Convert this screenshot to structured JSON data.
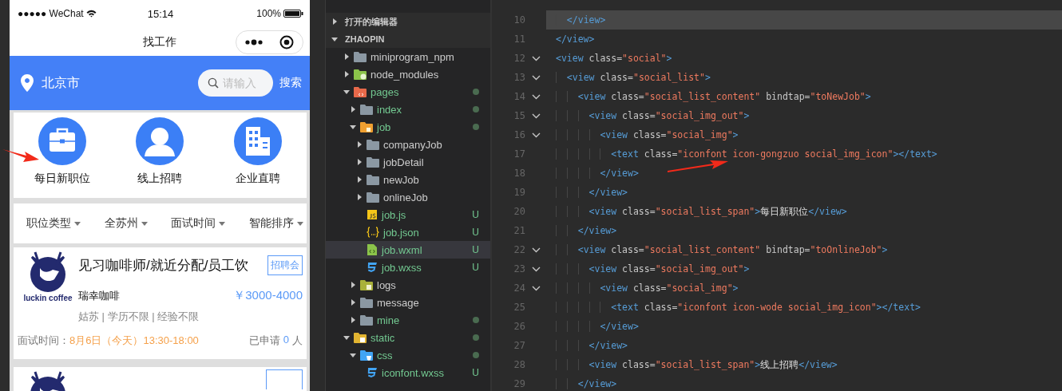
{
  "phone": {
    "status_bar": {
      "carrier": "●●●●● WeChat",
      "time": "15:14",
      "battery": "100%"
    },
    "nav": {
      "title": "找工作"
    },
    "header": {
      "city": "北京市",
      "search": {
        "placeholder": "请输入"
      },
      "search_button": "搜索"
    },
    "categories": [
      {
        "label": "每日新职位",
        "kind": "briefcase"
      },
      {
        "label": "线上招聘",
        "kind": "person"
      },
      {
        "label": "企业直聘",
        "kind": "building"
      }
    ],
    "filters": [
      "职位类型",
      "全苏州",
      "面试时间",
      "智能排序"
    ],
    "jobs": [
      {
        "logo_text": "luckin coffee",
        "title": "见习咖啡师/就近分配/员工饮",
        "badge": "招聘会",
        "company": "瑞幸咖啡",
        "salary": "￥3000-4000",
        "tags": "姑苏 | 学历不限 | 经验不限",
        "interview_label": "面试时间：",
        "interview_time": "8月6日（今天）13:30-18:00",
        "applied_label": "已申请",
        "applied_count": "0",
        "applied_unit": "人"
      }
    ]
  },
  "explorer": {
    "sections": [
      {
        "label": "打开的编辑器",
        "expanded": false
      },
      {
        "label": "ZHAOPIN",
        "expanded": true,
        "items": [
          {
            "name": "miniprogram_npm",
            "kind": "folder",
            "expanded": false,
            "changed": false,
            "modified": false,
            "selected": false
          },
          {
            "name": "node_modules",
            "kind": "folder-node",
            "expanded": false,
            "changed": false,
            "modified": false,
            "selected": false
          },
          {
            "name": "pages",
            "kind": "folder-pages",
            "expanded": true,
            "changed": true,
            "modified": true,
            "selected": false,
            "children": [
              {
                "name": "index",
                "kind": "folder",
                "expanded": false,
                "changed": true,
                "modified": true,
                "selected": false
              },
              {
                "name": "job",
                "kind": "folder-job",
                "expanded": true,
                "changed": true,
                "modified": true,
                "selected": false,
                "children": [
                  {
                    "name": "companyJob",
                    "kind": "folder",
                    "expanded": false,
                    "changed": false,
                    "modified": false,
                    "selected": false
                  },
                  {
                    "name": "jobDetail",
                    "kind": "folder",
                    "expanded": false,
                    "changed": false,
                    "modified": false,
                    "selected": false
                  },
                  {
                    "name": "newJob",
                    "kind": "folder",
                    "expanded": false,
                    "changed": false,
                    "modified": false,
                    "selected": false
                  },
                  {
                    "name": "onlineJob",
                    "kind": "folder",
                    "expanded": false,
                    "changed": false,
                    "modified": false,
                    "selected": false
                  },
                  {
                    "name": "job.js",
                    "kind": "js",
                    "changed": true,
                    "modified": false,
                    "badge": "U",
                    "selected": false
                  },
                  {
                    "name": "job.json",
                    "kind": "json",
                    "changed": true,
                    "modified": false,
                    "badge": "U",
                    "selected": false
                  },
                  {
                    "name": "job.wxml",
                    "kind": "wxml",
                    "changed": true,
                    "modified": false,
                    "badge": "U",
                    "selected": true
                  },
                  {
                    "name": "job.wxss",
                    "kind": "wxss",
                    "changed": true,
                    "modified": false,
                    "badge": "U",
                    "selected": false
                  }
                ]
              },
              {
                "name": "logs",
                "kind": "folder-logs",
                "expanded": false,
                "changed": false,
                "modified": false,
                "selected": false
              },
              {
                "name": "message",
                "kind": "folder",
                "expanded": false,
                "changed": false,
                "modified": false,
                "selected": false
              },
              {
                "name": "mine",
                "kind": "folder",
                "expanded": false,
                "changed": true,
                "modified": true,
                "selected": false
              }
            ]
          },
          {
            "name": "static",
            "kind": "folder-static",
            "expanded": true,
            "changed": true,
            "modified": true,
            "selected": false,
            "children": [
              {
                "name": "css",
                "kind": "folder-css",
                "expanded": true,
                "changed": true,
                "modified": true,
                "selected": false,
                "children": [
                  {
                    "name": "iconfont.wxss",
                    "kind": "wxss",
                    "changed": true,
                    "modified": false,
                    "badge": "U",
                    "selected": false
                  }
                ]
              }
            ]
          }
        ]
      }
    ]
  },
  "editor": {
    "lines": [
      {
        "number": "10",
        "current": true,
        "foldable": false,
        "tokens": [
          {
            "kind": "tag",
            "text": "  </view>"
          }
        ]
      },
      {
        "number": "11",
        "current": false,
        "foldable": false,
        "tokens": [
          {
            "kind": "tag",
            "text": "</view>"
          }
        ]
      },
      {
        "number": "12",
        "current": false,
        "foldable": true,
        "tokens": [
          {
            "kind": "tag",
            "text": "<view"
          },
          {
            "kind": "attr",
            "text": " class="
          },
          {
            "kind": "string",
            "text": "\"social\""
          },
          {
            "kind": "tag",
            "text": ">"
          }
        ]
      },
      {
        "number": "13",
        "current": false,
        "foldable": true,
        "tokens": [
          {
            "kind": "tag",
            "text": "  <view"
          },
          {
            "kind": "attr",
            "text": " class="
          },
          {
            "kind": "string",
            "text": "\"social_list\""
          },
          {
            "kind": "tag",
            "text": ">"
          }
        ]
      },
      {
        "number": "14",
        "current": false,
        "foldable": true,
        "tokens": [
          {
            "kind": "tag",
            "text": "    <view"
          },
          {
            "kind": "attr",
            "text": " class="
          },
          {
            "kind": "string",
            "text": "\"social_list_content\""
          },
          {
            "kind": "attr",
            "text": " bindtap="
          },
          {
            "kind": "string",
            "text": "\"toNewJob\""
          },
          {
            "kind": "tag",
            "text": ">"
          }
        ]
      },
      {
        "number": "15",
        "current": false,
        "foldable": true,
        "tokens": [
          {
            "kind": "tag",
            "text": "      <view"
          },
          {
            "kind": "attr",
            "text": " class="
          },
          {
            "kind": "string",
            "text": "\"social_img_out\""
          },
          {
            "kind": "tag",
            "text": ">"
          }
        ]
      },
      {
        "number": "16",
        "current": false,
        "foldable": true,
        "tokens": [
          {
            "kind": "tag",
            "text": "        <view"
          },
          {
            "kind": "attr",
            "text": " class="
          },
          {
            "kind": "string",
            "text": "\"social_img\""
          },
          {
            "kind": "tag",
            "text": ">"
          }
        ]
      },
      {
        "number": "17",
        "current": false,
        "foldable": false,
        "tokens": [
          {
            "kind": "tag",
            "text": "          <text"
          },
          {
            "kind": "attr",
            "text": " class="
          },
          {
            "kind": "string",
            "text": "\"iconfont icon-gongzuo social_img_icon\""
          },
          {
            "kind": "tag",
            "text": "></text>"
          }
        ]
      },
      {
        "number": "18",
        "current": false,
        "foldable": false,
        "tokens": [
          {
            "kind": "tag",
            "text": "        </view>"
          }
        ]
      },
      {
        "number": "19",
        "current": false,
        "foldable": false,
        "tokens": [
          {
            "kind": "tag",
            "text": "      </view>"
          }
        ]
      },
      {
        "number": "20",
        "current": false,
        "foldable": false,
        "tokens": [
          {
            "kind": "tag",
            "text": "      <view"
          },
          {
            "kind": "attr",
            "text": " class="
          },
          {
            "kind": "string",
            "text": "\"social_list_span\""
          },
          {
            "kind": "tag",
            "text": ">"
          },
          {
            "kind": "text",
            "text": "每日新职位"
          },
          {
            "kind": "tag",
            "text": "</view>"
          }
        ]
      },
      {
        "number": "21",
        "current": false,
        "foldable": false,
        "tokens": [
          {
            "kind": "tag",
            "text": "    </view>"
          }
        ]
      },
      {
        "number": "22",
        "current": false,
        "foldable": true,
        "tokens": [
          {
            "kind": "tag",
            "text": "    <view"
          },
          {
            "kind": "attr",
            "text": " class="
          },
          {
            "kind": "string",
            "text": "\"social_list_content\""
          },
          {
            "kind": "attr",
            "text": " bindtap="
          },
          {
            "kind": "string",
            "text": "\"toOnlineJob\""
          },
          {
            "kind": "tag",
            "text": ">"
          }
        ]
      },
      {
        "number": "23",
        "current": false,
        "foldable": true,
        "tokens": [
          {
            "kind": "tag",
            "text": "      <view"
          },
          {
            "kind": "attr",
            "text": " class="
          },
          {
            "kind": "string",
            "text": "\"social_img_out\""
          },
          {
            "kind": "tag",
            "text": ">"
          }
        ]
      },
      {
        "number": "24",
        "current": false,
        "foldable": true,
        "tokens": [
          {
            "kind": "tag",
            "text": "        <view"
          },
          {
            "kind": "attr",
            "text": " class="
          },
          {
            "kind": "string",
            "text": "\"social_img\""
          },
          {
            "kind": "tag",
            "text": ">"
          }
        ]
      },
      {
        "number": "25",
        "current": false,
        "foldable": false,
        "tokens": [
          {
            "kind": "tag",
            "text": "          <text"
          },
          {
            "kind": "attr",
            "text": " class="
          },
          {
            "kind": "string",
            "text": "\"iconfont icon-wode social_img_icon\""
          },
          {
            "kind": "tag",
            "text": "></text>"
          }
        ]
      },
      {
        "number": "26",
        "current": false,
        "foldable": false,
        "tokens": [
          {
            "kind": "tag",
            "text": "        </view>"
          }
        ]
      },
      {
        "number": "27",
        "current": false,
        "foldable": false,
        "tokens": [
          {
            "kind": "tag",
            "text": "      </view>"
          }
        ]
      },
      {
        "number": "28",
        "current": false,
        "foldable": false,
        "tokens": [
          {
            "kind": "tag",
            "text": "      <view"
          },
          {
            "kind": "attr",
            "text": " class="
          },
          {
            "kind": "string",
            "text": "\"social_list_span\""
          },
          {
            "kind": "tag",
            "text": ">"
          },
          {
            "kind": "text",
            "text": "线上招聘"
          },
          {
            "kind": "tag",
            "text": "</view>"
          }
        ]
      },
      {
        "number": "29",
        "current": false,
        "foldable": false,
        "tokens": [
          {
            "kind": "tag",
            "text": "    </view>"
          }
        ]
      }
    ]
  }
}
